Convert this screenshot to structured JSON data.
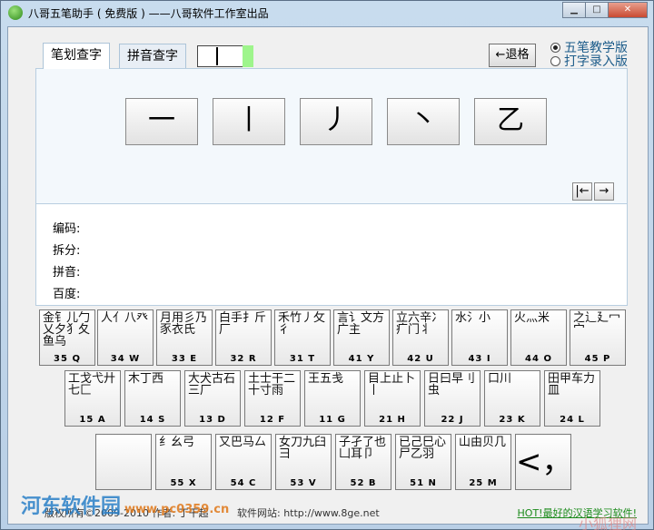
{
  "window": {
    "title": "八哥五笔助手 ( 免费版 ) ——八哥软件工作室出品",
    "controls": {
      "minimize": "▁",
      "maximize": "□",
      "close": "✕"
    }
  },
  "tabs": [
    {
      "label": "笔划查字",
      "active": true
    },
    {
      "label": "拼音查字",
      "active": false
    }
  ],
  "back_button": "←退格",
  "modes": [
    {
      "label": "五笔教学版",
      "selected": true
    },
    {
      "label": "打字录入版",
      "selected": false
    }
  ],
  "strokes": [
    "一",
    "丨",
    "丿",
    "丶",
    "乙"
  ],
  "nav": {
    "prev": "|←",
    "next": "→"
  },
  "info_labels": [
    "编码:",
    "拆分:",
    "拼音:",
    "百度:"
  ],
  "keyboard": {
    "row1": [
      {
        "roots": "金钅儿勹乂夕犭夂鱼乌",
        "code": "35 Q"
      },
      {
        "roots": "人亻八癶",
        "code": "34 W"
      },
      {
        "roots": "月用彡乃豕衣氏",
        "code": "33 E"
      },
      {
        "roots": "白手扌斤厂",
        "code": "32 R"
      },
      {
        "roots": "禾竹丿攵彳",
        "code": "31 T"
      },
      {
        "roots": "言讠文方广主",
        "code": "41 Y"
      },
      {
        "roots": "立六辛冫疒门丬",
        "code": "42 U"
      },
      {
        "roots": "水氵小",
        "code": "43 I"
      },
      {
        "roots": "火灬米",
        "code": "44 O"
      },
      {
        "roots": "之辶廴冖宀",
        "code": "45 P"
      }
    ],
    "row2": [
      {
        "roots": "工戈弋廾七匚",
        "code": "15 A"
      },
      {
        "roots": "木丁西",
        "code": "14 S"
      },
      {
        "roots": "大犬古石三厂",
        "code": "13 D"
      },
      {
        "roots": "土士干二十寸雨",
        "code": "12 F"
      },
      {
        "roots": "王五戋",
        "code": "11 G"
      },
      {
        "roots": "目上止卜丨",
        "code": "21 H"
      },
      {
        "roots": "日曰早刂虫",
        "code": "22 J"
      },
      {
        "roots": "口川",
        "code": "23 K"
      },
      {
        "roots": "田甲车力皿",
        "code": "24 L"
      }
    ],
    "row3": [
      {
        "roots": "",
        "code": ""
      },
      {
        "roots": "纟幺弓",
        "code": "55 X"
      },
      {
        "roots": "又巴马厶",
        "code": "54 C"
      },
      {
        "roots": "女刀九臼彐",
        "code": "53 V"
      },
      {
        "roots": "子孑了也凵耳卩",
        "code": "52 B"
      },
      {
        "roots": "已己巳心尸乙羽",
        "code": "51 N"
      },
      {
        "roots": "山由贝几",
        "code": "25 M"
      },
      {
        "roots": "",
        "code": "",
        "symbol": "<，"
      }
    ]
  },
  "footer": {
    "copyright": "版权所有©2009-2010 作者: 丁干超",
    "site": "软件网站: http://www.8ge.net",
    "promo": "HOT!最好的汉语学习软件!"
  },
  "watermarks": {
    "left": "河东软件园",
    "left_sub": "www.pc0359.cn",
    "right": "小狐狸网"
  },
  "colors": {
    "indicator": "#9ef58c",
    "link": "#1a8a1a",
    "radio_text": "#1c5c8a"
  }
}
